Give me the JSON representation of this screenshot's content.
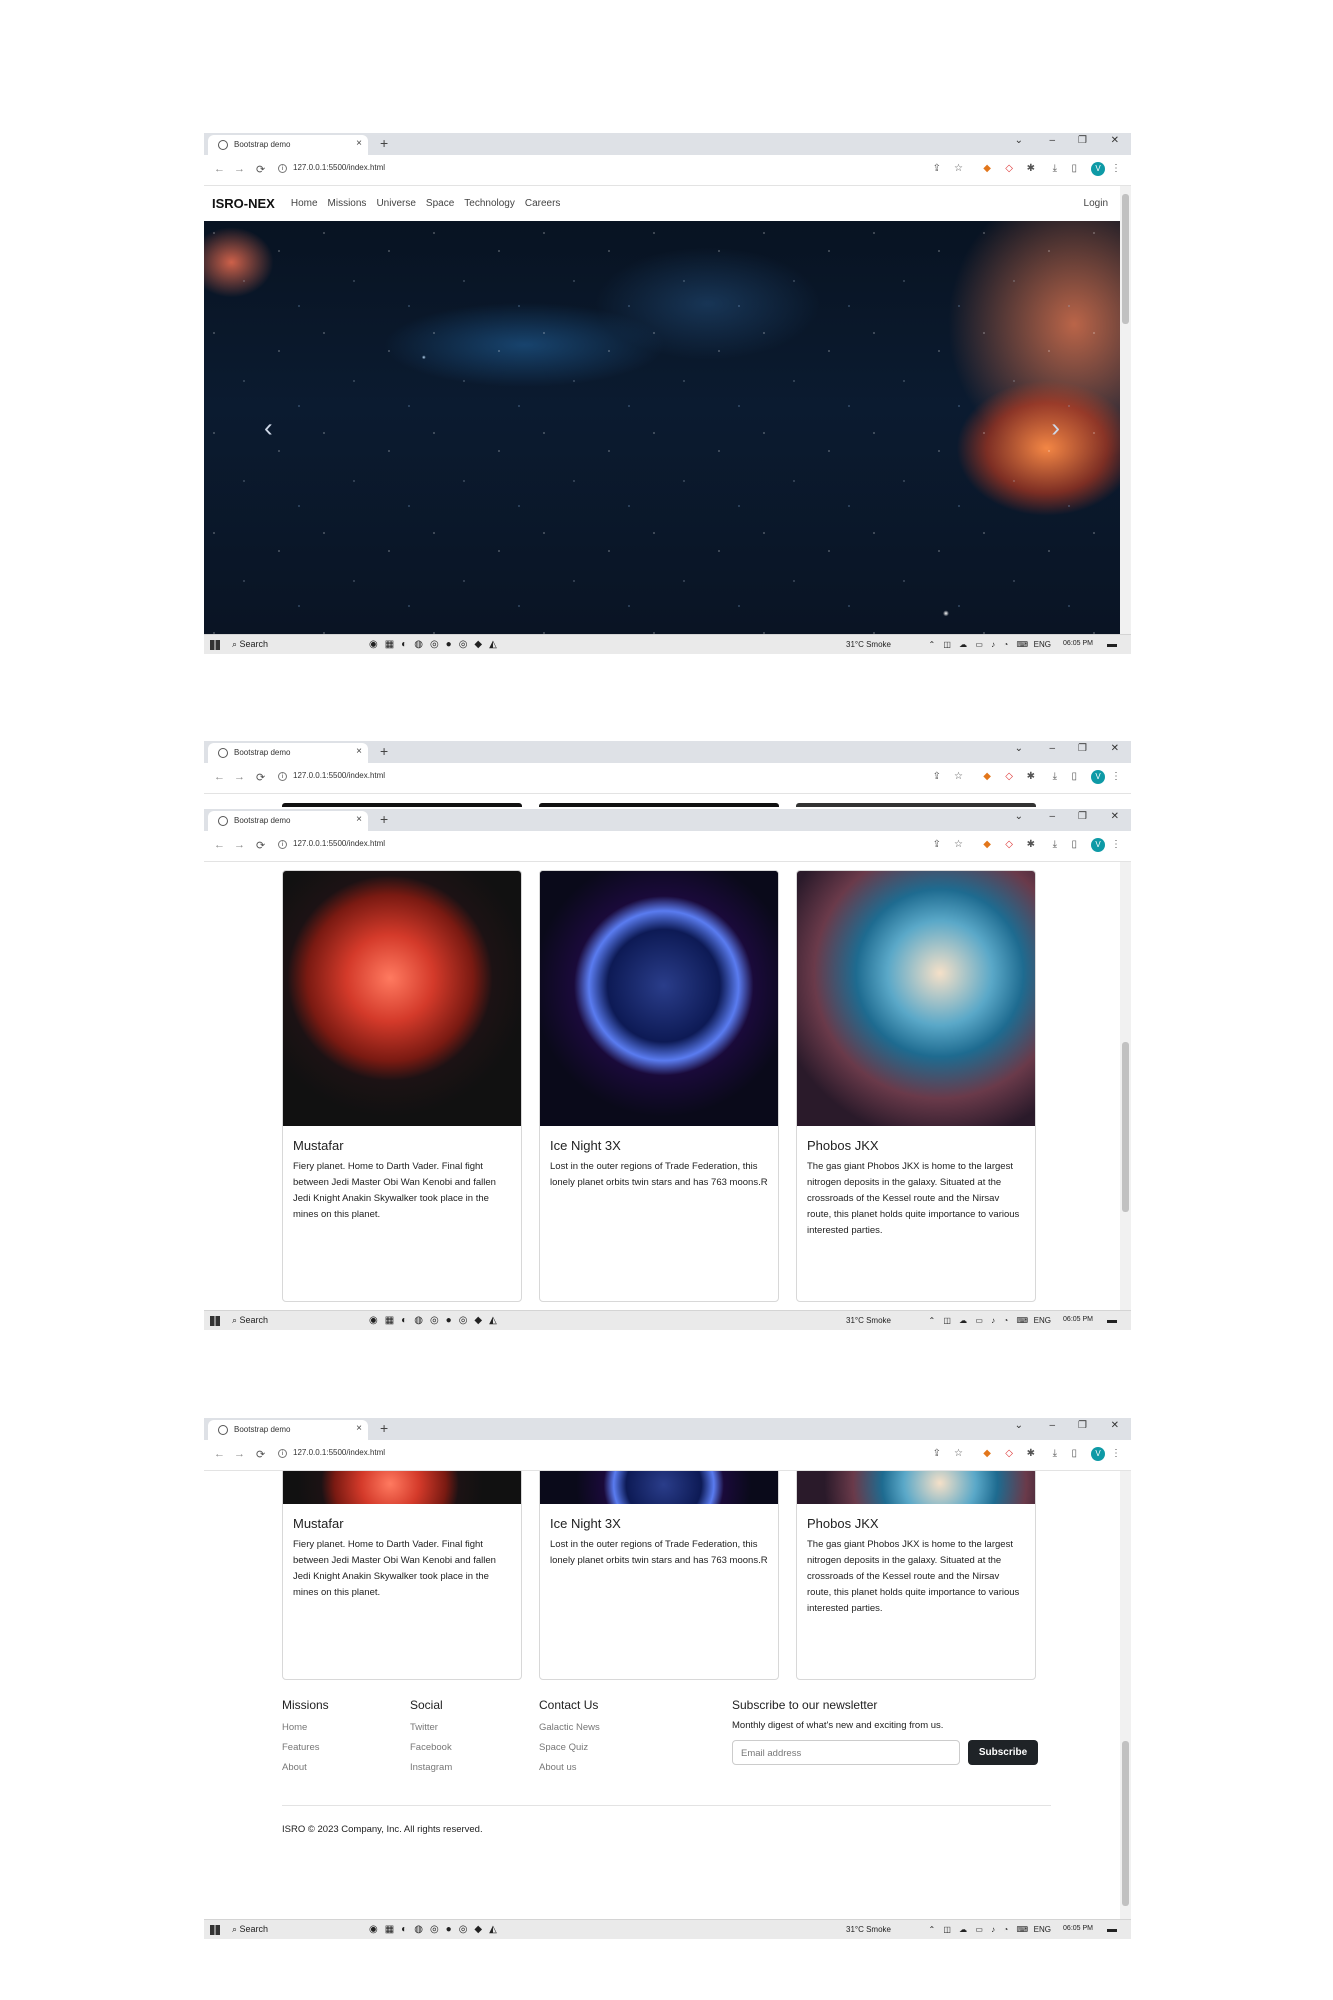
{
  "browser": {
    "tab_title": "Bootstrap demo",
    "url": "127.0.0.1:5500/index.html",
    "profile_initial": "V"
  },
  "site": {
    "brand": "ISRO-NEX",
    "nav": [
      "Home",
      "Missions",
      "Universe",
      "Space",
      "Technology",
      "Careers"
    ],
    "login": "Login"
  },
  "cards": [
    {
      "title": "Mustafar",
      "text": "Fiery planet. Home to Darth Vader. Final fight between Jedi Master Obi Wan Kenobi and fallen Jedi Knight Anakin Skywalker took place in the mines on this planet."
    },
    {
      "title": "Ice Night 3X",
      "text": "Lost in the outer regions of Trade Federation, this lonely planet orbits twin stars and has 763 moons.R"
    },
    {
      "title": "Phobos JKX",
      "text": "The gas giant Phobos JKX is home to the largest nitrogen deposits in the galaxy. Situated at the crossroads of the Kessel route and the Nirsav route, this planet holds quite importance to various interested parties."
    }
  ],
  "footer": {
    "columns": [
      {
        "heading": "Missions",
        "links": [
          "Home",
          "Features",
          "About"
        ]
      },
      {
        "heading": "Social",
        "links": [
          "Twitter",
          "Facebook",
          "Instagram"
        ]
      },
      {
        "heading": "Contact Us",
        "links": [
          "Galactic News",
          "Space Quiz",
          "About us"
        ]
      }
    ],
    "newsletter": {
      "heading": "Subscribe to our newsletter",
      "subtext": "Monthly digest of what's new and exciting from us.",
      "placeholder": "Email address",
      "button": "Subscribe"
    },
    "copyright": "ISRO © 2023 Company, Inc. All rights reserved."
  },
  "taskbar": {
    "search": "Search",
    "weather": "31°C  Smoke",
    "lang": "ENG",
    "time": "06:05 PM"
  }
}
